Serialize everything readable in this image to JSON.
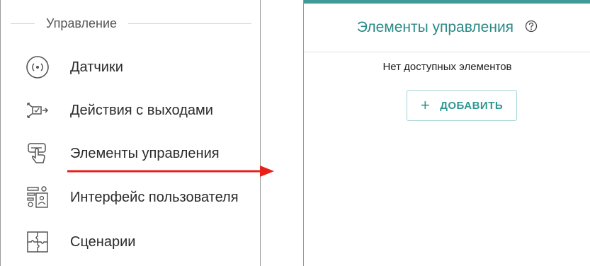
{
  "left_panel": {
    "section_title": "Управление",
    "items": [
      {
        "label": "Датчики",
        "icon": "sensor-icon"
      },
      {
        "label": "Действия с выходами",
        "icon": "output-actions-icon"
      },
      {
        "label": "Элементы управления",
        "icon": "touch-control-icon"
      },
      {
        "label": "Интерфейс пользователя",
        "icon": "user-interface-icon"
      },
      {
        "label": "Сценарии",
        "icon": "puzzle-icon"
      }
    ]
  },
  "right_panel": {
    "title": "Элементы управления",
    "help_icon": "help-icon",
    "empty_text": "Нет доступных элементов",
    "add_button": {
      "plus": "+",
      "label": "ДОБАВИТЬ"
    }
  },
  "colors": {
    "accent": "#3f9a98",
    "title_teal": "#2a8a86",
    "arrow_red": "#e8201a"
  }
}
